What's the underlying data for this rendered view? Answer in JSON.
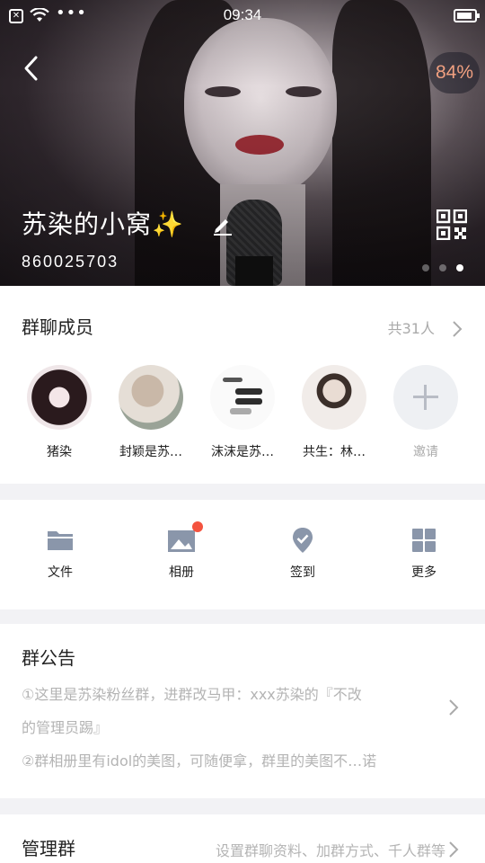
{
  "status_bar": {
    "time": "09:34",
    "icons": [
      "sim-icon",
      "wifi-icon",
      "more-dots-icon",
      "battery-icon"
    ]
  },
  "header": {
    "group_name": "苏染的小窝✨",
    "group_id": "860025703",
    "overlay_percent": "84%",
    "pager": {
      "count": 3,
      "active": 3
    }
  },
  "members": {
    "title": "群聊成员",
    "count": "共31人",
    "list": [
      {
        "name": "猪染"
      },
      {
        "name": "封颖是苏…"
      },
      {
        "name": "沫沫是苏…"
      },
      {
        "name": "共生：林…"
      }
    ],
    "invite_label": "邀请"
  },
  "tools": [
    {
      "label": "文件",
      "icon": "folder-icon"
    },
    {
      "label": "相册",
      "icon": "album-icon"
    },
    {
      "label": "签到",
      "icon": "checkin-icon"
    },
    {
      "label": "更多",
      "icon": "grid-icon"
    }
  ],
  "notice": {
    "title": "群公告",
    "lines": [
      "①这里是苏染粉丝群，进群改马甲：xxx苏染的『不改",
      "的管理员踢』",
      "②群相册里有idol的美图，可随便拿，群里的美图不…诺"
    ]
  },
  "manage": {
    "title": "管理群",
    "desc": "设置群聊资料、加群方式、千人群等"
  },
  "colors": {
    "accent_red": "#f4533f",
    "icon_gray": "#8a96aa",
    "percent_text": "#f0a080",
    "muted_text": "#b4b4b4"
  }
}
